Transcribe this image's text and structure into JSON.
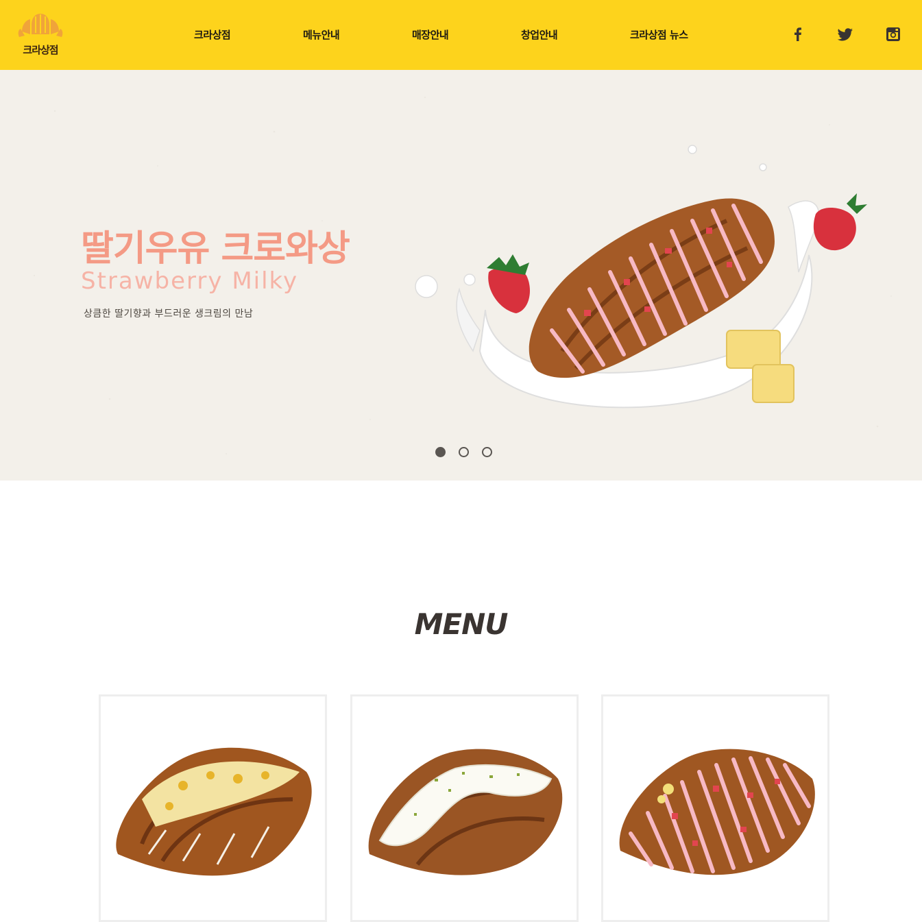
{
  "brand": {
    "logo_text": "크라상점"
  },
  "nav": {
    "items": [
      "크라상점",
      "메뉴안내",
      "매장안내",
      "창업안내",
      "크라상점 뉴스"
    ]
  },
  "social": [
    "facebook-icon",
    "twitter-icon",
    "instagram-icon"
  ],
  "hero": {
    "title": "딸기우유 크로와상",
    "subtitle": "Strawberry Milky",
    "description": "상큼한 딸기향과 부드러운 생크림의 만남",
    "slides": 3,
    "active_slide": 1
  },
  "menu": {
    "title": "MENU",
    "cards": [
      "cheese-croissant",
      "cream-croissant",
      "strawberry-croissant"
    ]
  },
  "colors": {
    "header_bg": "#fdd31c",
    "hero_title": "#f49a85",
    "hero_subtitle": "#f6b3a6",
    "text_dark": "#3a3431"
  }
}
